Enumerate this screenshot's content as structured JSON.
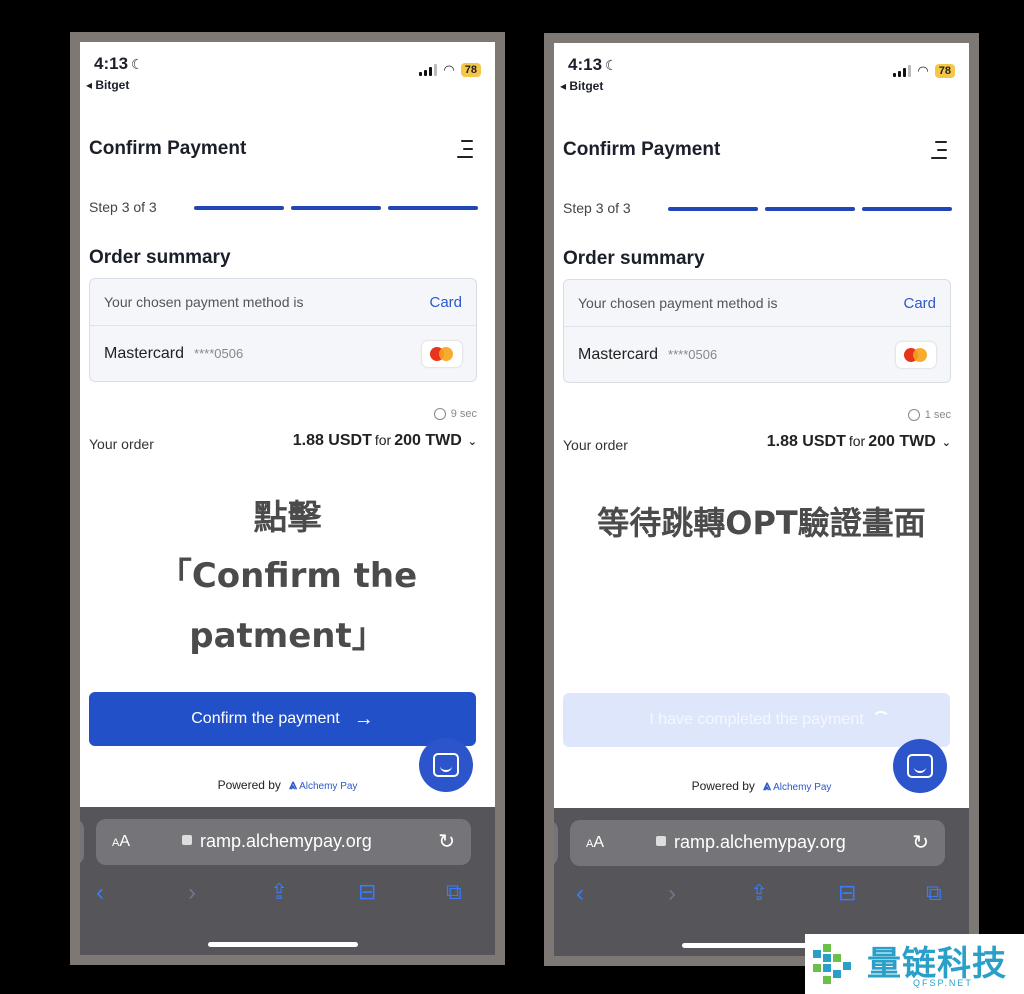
{
  "left": {
    "status": {
      "time": "4:13",
      "back_app": "◂ Bitget",
      "battery": "78"
    },
    "title": "Confirm Payment",
    "step": "Step 3 of 3",
    "order_summary": "Order summary",
    "payment_method_label": "Your chosen payment method is",
    "payment_method_value": "Card",
    "card_name": "Mastercard",
    "card_mask": "****0506",
    "timer": "9  sec",
    "your_order_label": "Your order",
    "amount": "1.88 USDT",
    "for": "for",
    "fiat": "200 TWD",
    "overlay_lines": [
      "點擊",
      "「Confirm the",
      "patment」"
    ],
    "button": "Confirm the payment",
    "powered_by": "Powered by",
    "brand": "Alchemy Pay",
    "url": "ramp.alchemypay.org",
    "aa": "AA"
  },
  "right": {
    "status": {
      "time": "4:13",
      "back_app": "◂ Bitget",
      "battery": "78"
    },
    "title": "Confirm Payment",
    "step": "Step 3 of 3",
    "order_summary": "Order summary",
    "payment_method_label": "Your chosen payment method is",
    "payment_method_value": "Card",
    "card_name": "Mastercard",
    "card_mask": "****0506",
    "timer": "1  sec",
    "your_order_label": "Your order",
    "amount": "1.88 USDT",
    "for": "for",
    "fiat": "200 TWD",
    "overlay": "等待跳轉OPT驗證畫面",
    "button": "I have completed the payment",
    "powered_by": "Powered by",
    "brand": "Alchemy Pay",
    "url": "ramp.alchemypay.org",
    "aa": "AA"
  },
  "watermark": {
    "text": "量链科技",
    "sub": "QFSP.NET"
  },
  "colors": {
    "primary": "#2250c8",
    "disabled": "#dde6fa",
    "link": "#2c58c8",
    "watermark": "#2aa0c9"
  }
}
